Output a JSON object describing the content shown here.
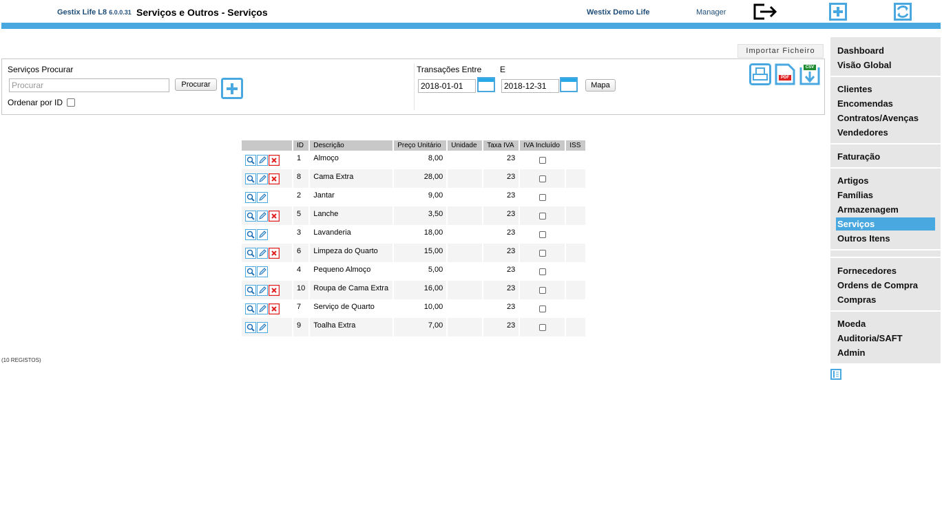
{
  "header": {
    "app_name": "Gestix Life L8",
    "app_version": "6.0.0.31",
    "page_title": "Serviços e Outros - Serviços",
    "company": "Westix Demo Life",
    "user": "Manager"
  },
  "icons": {
    "logout": "logout-icon",
    "add": "plus-icon",
    "refresh": "refresh-icon"
  },
  "colors": {
    "accent": "#4aa8e0",
    "delete": "#e01f1f"
  },
  "import_button": "Importar Ficheiro",
  "search": {
    "label": "Serviços Procurar",
    "placeholder": "Procurar",
    "value": "",
    "search_button": "Procurar",
    "order_by_id_label": "Ordenar por ID"
  },
  "transactions": {
    "label": "Transações Entre",
    "and_label": "E",
    "date_from": "2018-01-01",
    "date_to": "2018-12-31",
    "map_button": "Mapa"
  },
  "export": {
    "pdf_text": "PDF",
    "csv_text": "CSV"
  },
  "table": {
    "columns": [
      "",
      "ID",
      "Descrição",
      "Preço Unitário",
      "Unidade",
      "Taxa IVA",
      "IVA Incluído",
      "ISS"
    ],
    "rows": [
      {
        "id": "1",
        "desc": "Almoço",
        "price": "8,00",
        "unit": "",
        "vat": "23",
        "deletable": true
      },
      {
        "id": "8",
        "desc": "Cama Extra",
        "price": "28,00",
        "unit": "",
        "vat": "23",
        "deletable": true
      },
      {
        "id": "2",
        "desc": "Jantar",
        "price": "9,00",
        "unit": "",
        "vat": "23",
        "deletable": false
      },
      {
        "id": "5",
        "desc": "Lanche",
        "price": "3,50",
        "unit": "",
        "vat": "23",
        "deletable": true
      },
      {
        "id": "3",
        "desc": "Lavanderia",
        "price": "18,00",
        "unit": "",
        "vat": "23",
        "deletable": false
      },
      {
        "id": "6",
        "desc": "Limpeza do Quarto",
        "price": "15,00",
        "unit": "",
        "vat": "23",
        "deletable": true
      },
      {
        "id": "4",
        "desc": "Pequeno Almoço",
        "price": "5,00",
        "unit": "",
        "vat": "23",
        "deletable": false
      },
      {
        "id": "10",
        "desc": "Roupa de Cama Extra",
        "price": "16,00",
        "unit": "",
        "vat": "23",
        "deletable": true
      },
      {
        "id": "7",
        "desc": "Serviço de Quarto",
        "price": "10,00",
        "unit": "",
        "vat": "23",
        "deletable": true
      },
      {
        "id": "9",
        "desc": "Toalha Extra",
        "price": "7,00",
        "unit": "",
        "vat": "23",
        "deletable": false
      }
    ]
  },
  "records_count": "(10 REGISTOS)",
  "menu": {
    "groups": [
      [
        "Dashboard",
        "Visão Global"
      ],
      [
        "Clientes",
        "Encomendas",
        "Contratos/Avenças",
        "Vendedores"
      ],
      [
        "Faturação"
      ],
      [
        "Artigos",
        "Famílias",
        "Armazenagem",
        "Serviços",
        "Outros Itens"
      ],
      [
        "Fornecedores",
        "Ordens de Compra",
        "Compras"
      ],
      [
        "Moeda",
        "Auditoria/SAFT",
        "Admin"
      ]
    ],
    "active": "Serviços"
  }
}
